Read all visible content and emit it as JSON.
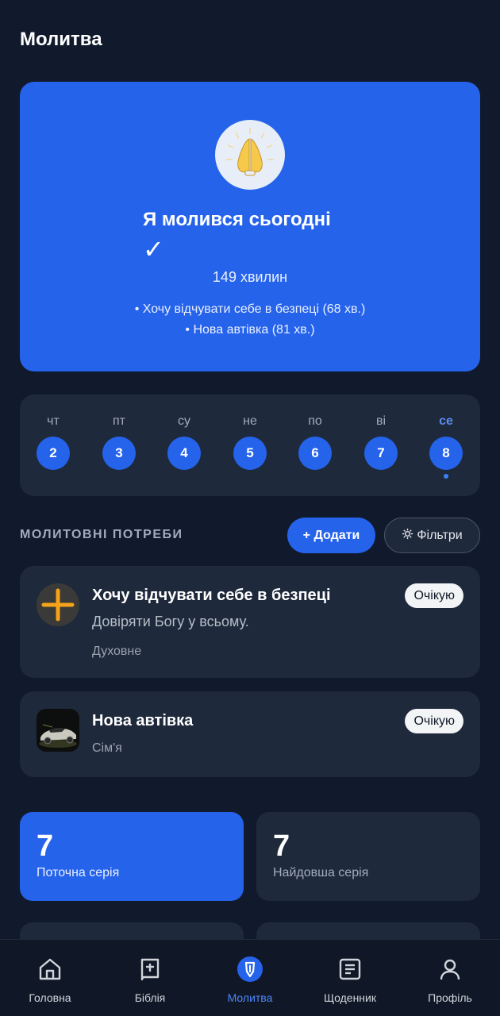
{
  "header": {
    "title": "Молитва"
  },
  "hero": {
    "title": "Я молився сьогодні",
    "check": "✓",
    "minutes": "149 хвилин",
    "lines": [
      "• Хочу відчувати себе в безпеці (68 хв.)",
      "• Нова автівка (81 хв.)"
    ]
  },
  "week": {
    "days": [
      {
        "label": "чт",
        "num": "2"
      },
      {
        "label": "пт",
        "num": "3"
      },
      {
        "label": "су",
        "num": "4"
      },
      {
        "label": "не",
        "num": "5"
      },
      {
        "label": "по",
        "num": "6"
      },
      {
        "label": "ві",
        "num": "7"
      },
      {
        "label": "се",
        "num": "8"
      }
    ],
    "active_index": 6
  },
  "needs_section": {
    "title": "МОЛИТОВНІ ПОТРЕБИ",
    "add_label": "+ Додати",
    "filter_label": "Фільтри"
  },
  "needs": [
    {
      "title": "Хочу відчувати себе в безпеці",
      "description": "Довіряти Богу у всьому.",
      "category": "Духовне",
      "status": "Очікую",
      "icon": "plus-icon"
    },
    {
      "title": "Нова автівка",
      "category": "Сім'я",
      "status": "Очікую",
      "icon": "car-photo"
    }
  ],
  "stats": {
    "current": {
      "value": "7",
      "label": "Поточна серія"
    },
    "longest": {
      "value": "7",
      "label": "Найдовша серія"
    }
  },
  "nav": {
    "items": [
      {
        "label": "Головна",
        "icon": "home-icon"
      },
      {
        "label": "Біблія",
        "icon": "bible-icon"
      },
      {
        "label": "Молитва",
        "icon": "prayer-shield-icon"
      },
      {
        "label": "Щоденник",
        "icon": "journal-icon"
      },
      {
        "label": "Профіль",
        "icon": "profile-icon"
      }
    ],
    "active_index": 2
  },
  "colors": {
    "background": "#111a2c",
    "card": "#1e293b",
    "accent": "#2563eb",
    "active_nav": "#4f86f7"
  }
}
